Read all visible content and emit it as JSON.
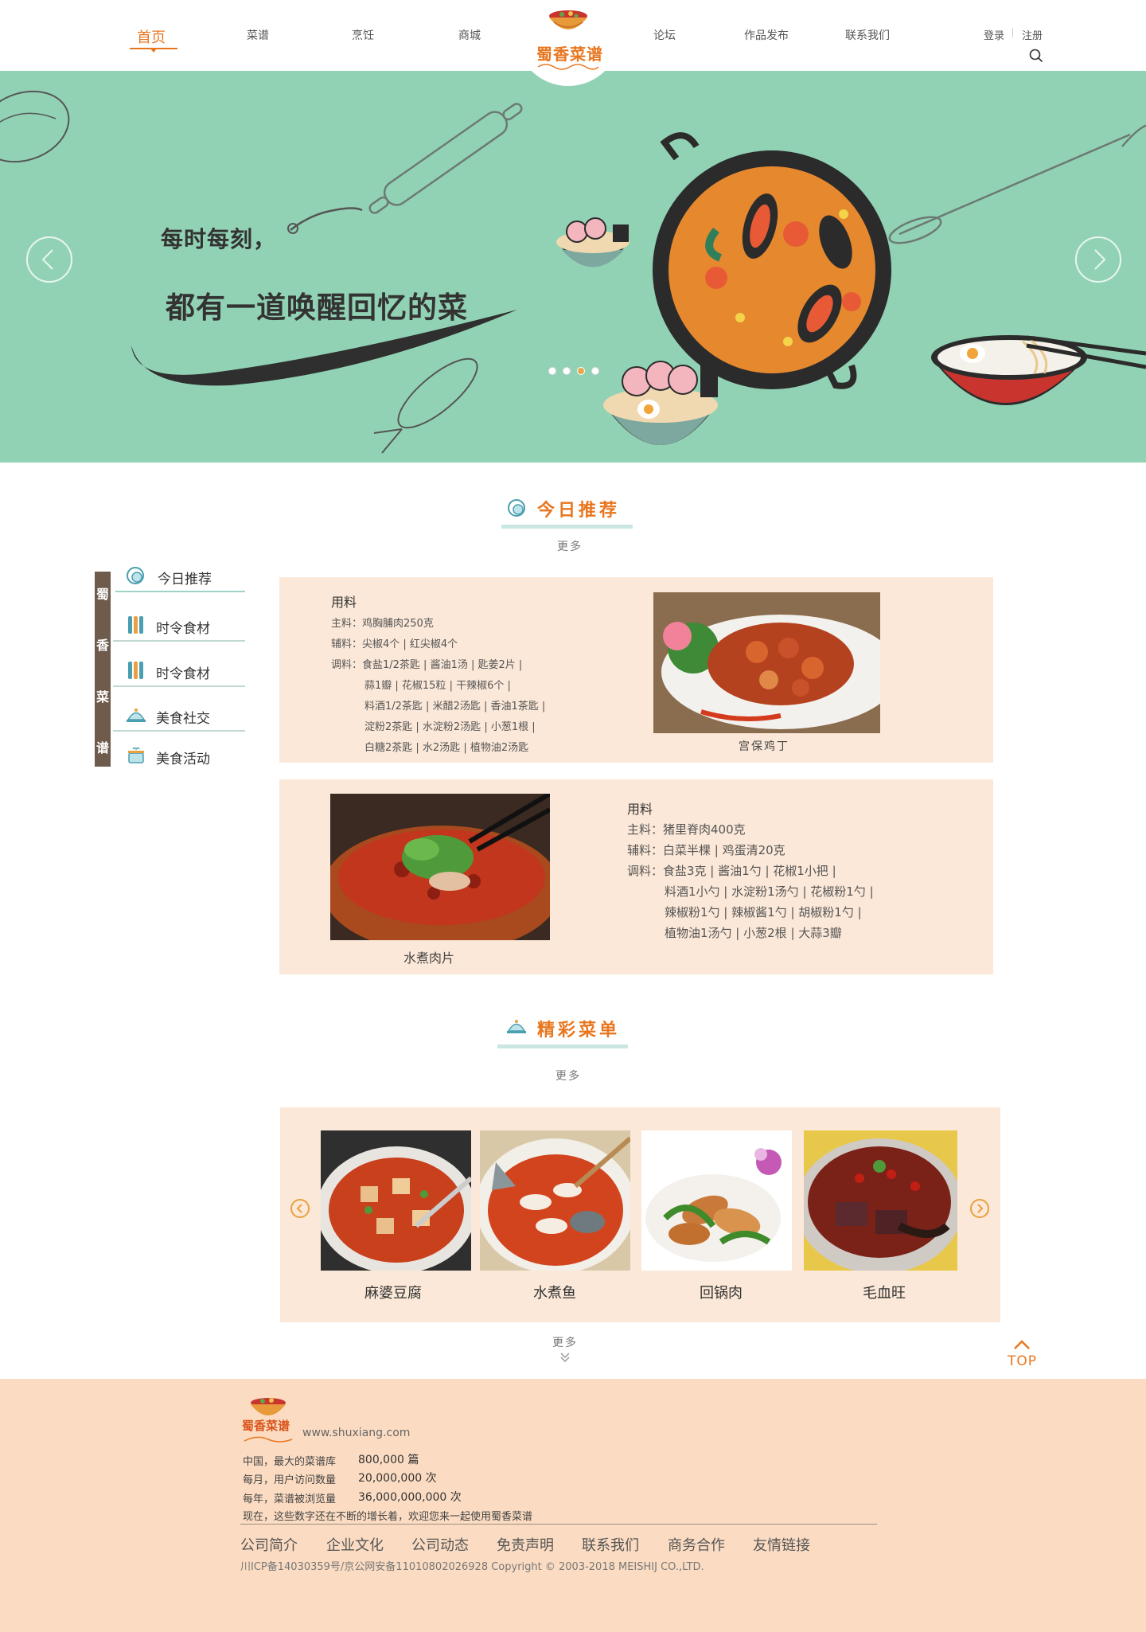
{
  "nav": {
    "items": [
      "首页",
      "菜谱",
      "烹饪",
      "商城",
      "论坛",
      "作品发布",
      "联系我们"
    ],
    "logo_text": "蜀香菜谱",
    "login": "登录",
    "register": "注册"
  },
  "banner": {
    "line1": "每时每刻，",
    "line2": "都有一道唤醒回忆的菜",
    "slide_count": 4,
    "active_slide": 3
  },
  "today": {
    "title": "今日推荐",
    "more": "更多"
  },
  "side_menu": {
    "vertical_chars": [
      "蜀",
      "香",
      "菜",
      "谱"
    ],
    "items": [
      "今日推荐",
      "时令食材",
      "时令食材",
      "美食社交",
      "美食活动"
    ]
  },
  "recipe1": {
    "heading": "用料",
    "lines": [
      "主料：鸡胸脯肉250克",
      "辅料：尖椒4个 | 红尖椒4个",
      "调料：食盐1/2茶匙 | 酱油1汤 | 匙姜2片 |",
      "蒜1瓣 | 花椒15粒 | 干辣椒6个 |",
      "料酒1/2茶匙 | 米醋2汤匙 | 香油1茶匙 |",
      "淀粉2茶匙 | 水淀粉2汤匙 | 小葱1根 |",
      "白糖2茶匙 | 水2汤匙 | 植物油2汤匙"
    ],
    "caption": "宫保鸡丁"
  },
  "recipe2": {
    "heading": "用料",
    "lines": [
      "主料：猪里脊肉400克",
      "辅料：白菜半棵 | 鸡蛋清20克",
      "调料：食盐3克 | 酱油1勺 | 花椒1小把 |",
      "料酒1小勺 | 水淀粉1汤勺 | 花椒粉1勺 |",
      "辣椒粉1勺 | 辣椒酱1勺 | 胡椒粉1勺 |",
      "植物油1汤勺 | 小葱2根 | 大蒜3瓣"
    ],
    "caption": "水煮肉片"
  },
  "menu": {
    "title": "精彩菜单",
    "more": "更多",
    "dishes": [
      "麻婆豆腐",
      "水煮鱼",
      "回锅肉",
      "毛血旺"
    ],
    "bottom_more": "更多"
  },
  "top_button": "TOP",
  "footer": {
    "url": "www.shuxiang.com",
    "stats": [
      {
        "label": "中国，最大的菜谱库",
        "value": "800,000 篇"
      },
      {
        "label": "每月，用户访问数量",
        "value": "20,000,000 次"
      },
      {
        "label": "每年，菜谱被浏览量",
        "value": "36,000,000,000 次"
      }
    ],
    "slogan": "现在，这些数字还在不断的增长着，欢迎您来一起使用蜀香菜谱",
    "links": [
      "公司简介",
      "企业文化",
      "公司动态",
      "免责声明",
      "联系我们",
      "商务合作",
      "友情链接"
    ],
    "copyright": "川ICP备14030359号/京公网安备11010802026928 Copyright © 2003-2018 MEISHIJ CO.,LTD."
  },
  "colors": {
    "accent": "#e8761f",
    "banner_bg": "#92d2b4",
    "card_bg": "#fbe8d8",
    "footer_bg": "#fbdcc2",
    "side_strip": "#6f5b4c"
  }
}
